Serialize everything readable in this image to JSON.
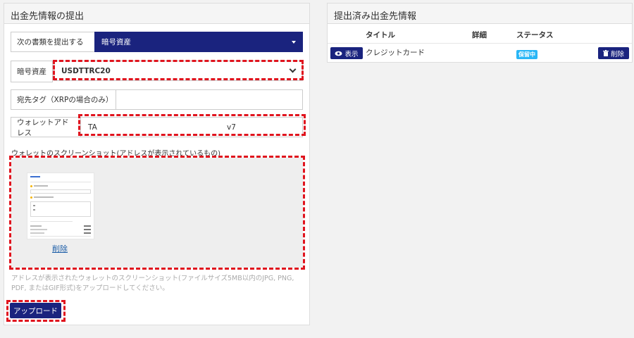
{
  "left_panel": {
    "title": "出金先情報の提出",
    "doc_type": {
      "label": "次の書類を提出する",
      "selected": "暗号資産"
    },
    "crypto": {
      "label": "暗号資産",
      "selected": "USDTTRC20"
    },
    "dest_tag": {
      "label": "宛先タグ（XRPの場合のみ）",
      "value": ""
    },
    "wallet": {
      "label": "ウォレットアドレス",
      "value_start": "TA",
      "value_end": "v7"
    },
    "screenshot": {
      "label": "ウォレットのスクリーンショット(アドレスが表示されているもの)",
      "delete_link": "削除"
    },
    "help_text": "アドレスが表示されたウォレットのスクリーンショット(ファイルサイズ5MB以内のJPG, PNG, PDF, またはGIF形式)をアップロードしてください。",
    "upload_button": "アップロード"
  },
  "right_panel": {
    "title": "提出済み出金先情報",
    "columns": {
      "title": "タイトル",
      "detail": "詳細",
      "status": "ステータス"
    },
    "rows": [
      {
        "view_label": "表示",
        "title": "クレジットカード",
        "detail": "",
        "status": "保留中",
        "delete_label": "削除"
      }
    ]
  },
  "colors": {
    "navy": "#1a237e",
    "highlight": "#e0141e",
    "status_badge": "#29b6f6"
  },
  "icons": [
    "caret-down-icon",
    "chevron-down-icon",
    "eye-icon",
    "trash-icon"
  ]
}
